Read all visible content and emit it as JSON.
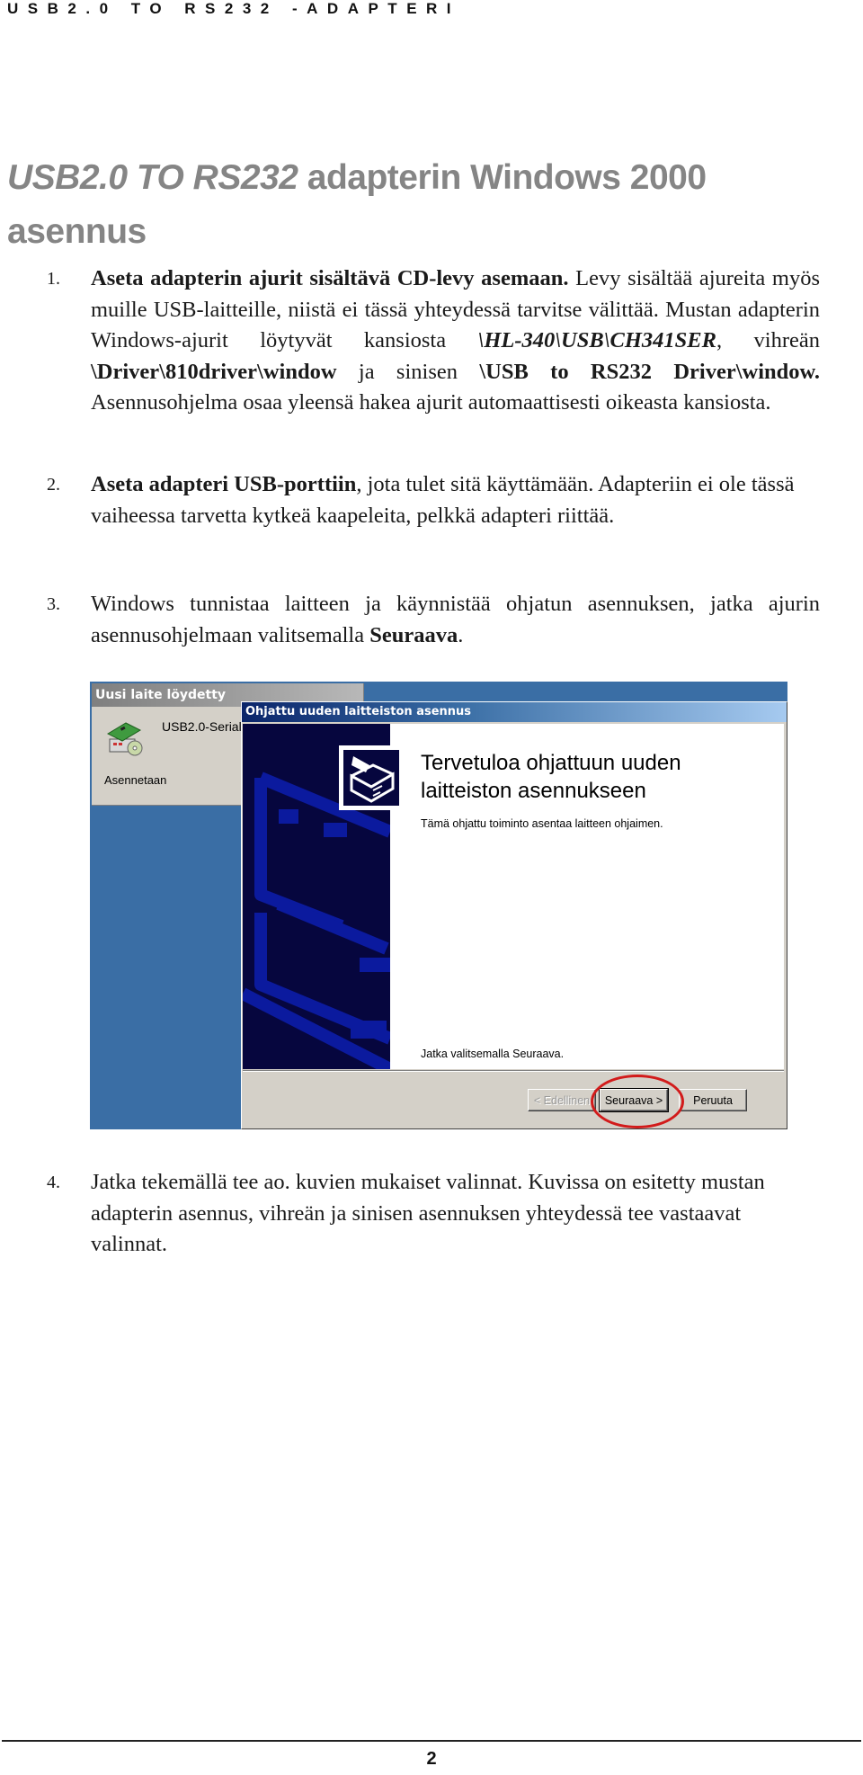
{
  "running_header": "USB2.0 TO RS232 -ADAPTERI",
  "title": {
    "italic_part": "USB2.0 TO RS232",
    "rest_line1": " adapterin Windows 2000",
    "line2": "asennus"
  },
  "steps": [
    {
      "number": "1.",
      "bold_lead": "Aseta adapterin ajurit sisältävä CD-levy asemaan.",
      "text_a": " Levy sisältää ajureita myös muille USB-laitteille, niistä ei tässä yhteydessä tarvitse välittää. Mustan adapterin Windows-ajurit löytyvät kansiosta ",
      "path_black": "\\HL-340\\USB\\CH341SER",
      "text_b": ", vihreän ",
      "path_green": "\\Driver\\810driver\\window",
      "text_c": " ja sinisen ",
      "path_blue": "\\USB to RS232 Driver\\window.",
      "text_d": " Asennusohjelma osaa yleensä hakea ajurit automaattisesti oikeasta kansiosta."
    },
    {
      "number": "2.",
      "bold_lead": "Aseta adapteri USB-porttiin",
      "text_a": ", jota tulet sitä käyttämään. Adapteriin ei ole tässä vaiheessa tarvetta kytkeä kaapeleita, pelkkä adapteri riittää."
    },
    {
      "number": "3.",
      "text_a": "Windows tunnistaa laitteen ja käynnistää ohjatun asennuksen, jatka ajurin asennusohjelmaan valitsemalla ",
      "bold_tail": "Seuraava",
      "text_b": "."
    },
    {
      "number": "4.",
      "text_a": "Jatka tekemällä tee ao. kuvien mukaiset valinnat. Kuvissa on esitetty mustan adapterin asennus, vihreän ja sinisen asennuksen yhteydessä tee vastaavat valinnat."
    }
  ],
  "screenshot": {
    "found_window": {
      "title": "Uusi laite löydetty",
      "device_name": "USB2.0-Serial",
      "status": "Asennetaan",
      "icon": "hardware-install-icon"
    },
    "wizard": {
      "title": "Ohjattu uuden laitteiston asennus",
      "heading": "Tervetuloa ohjattuun uuden laitteiston asennukseen",
      "description": "Tämä ohjattu toiminto asentaa laitteen ohjaimen.",
      "continue_hint": "Jatka valitsemalla Seuraava.",
      "logo_icon": "hardware-wizard-icon",
      "buttons": {
        "back": "< Edellinen",
        "next": "Seuraava >",
        "cancel": "Peruuta"
      },
      "highlighted_button": "next",
      "highlight_color": "#d21b1b"
    },
    "desktop_color": "#3a6ea5",
    "banner_color": "#06063e"
  },
  "page_number": "2"
}
